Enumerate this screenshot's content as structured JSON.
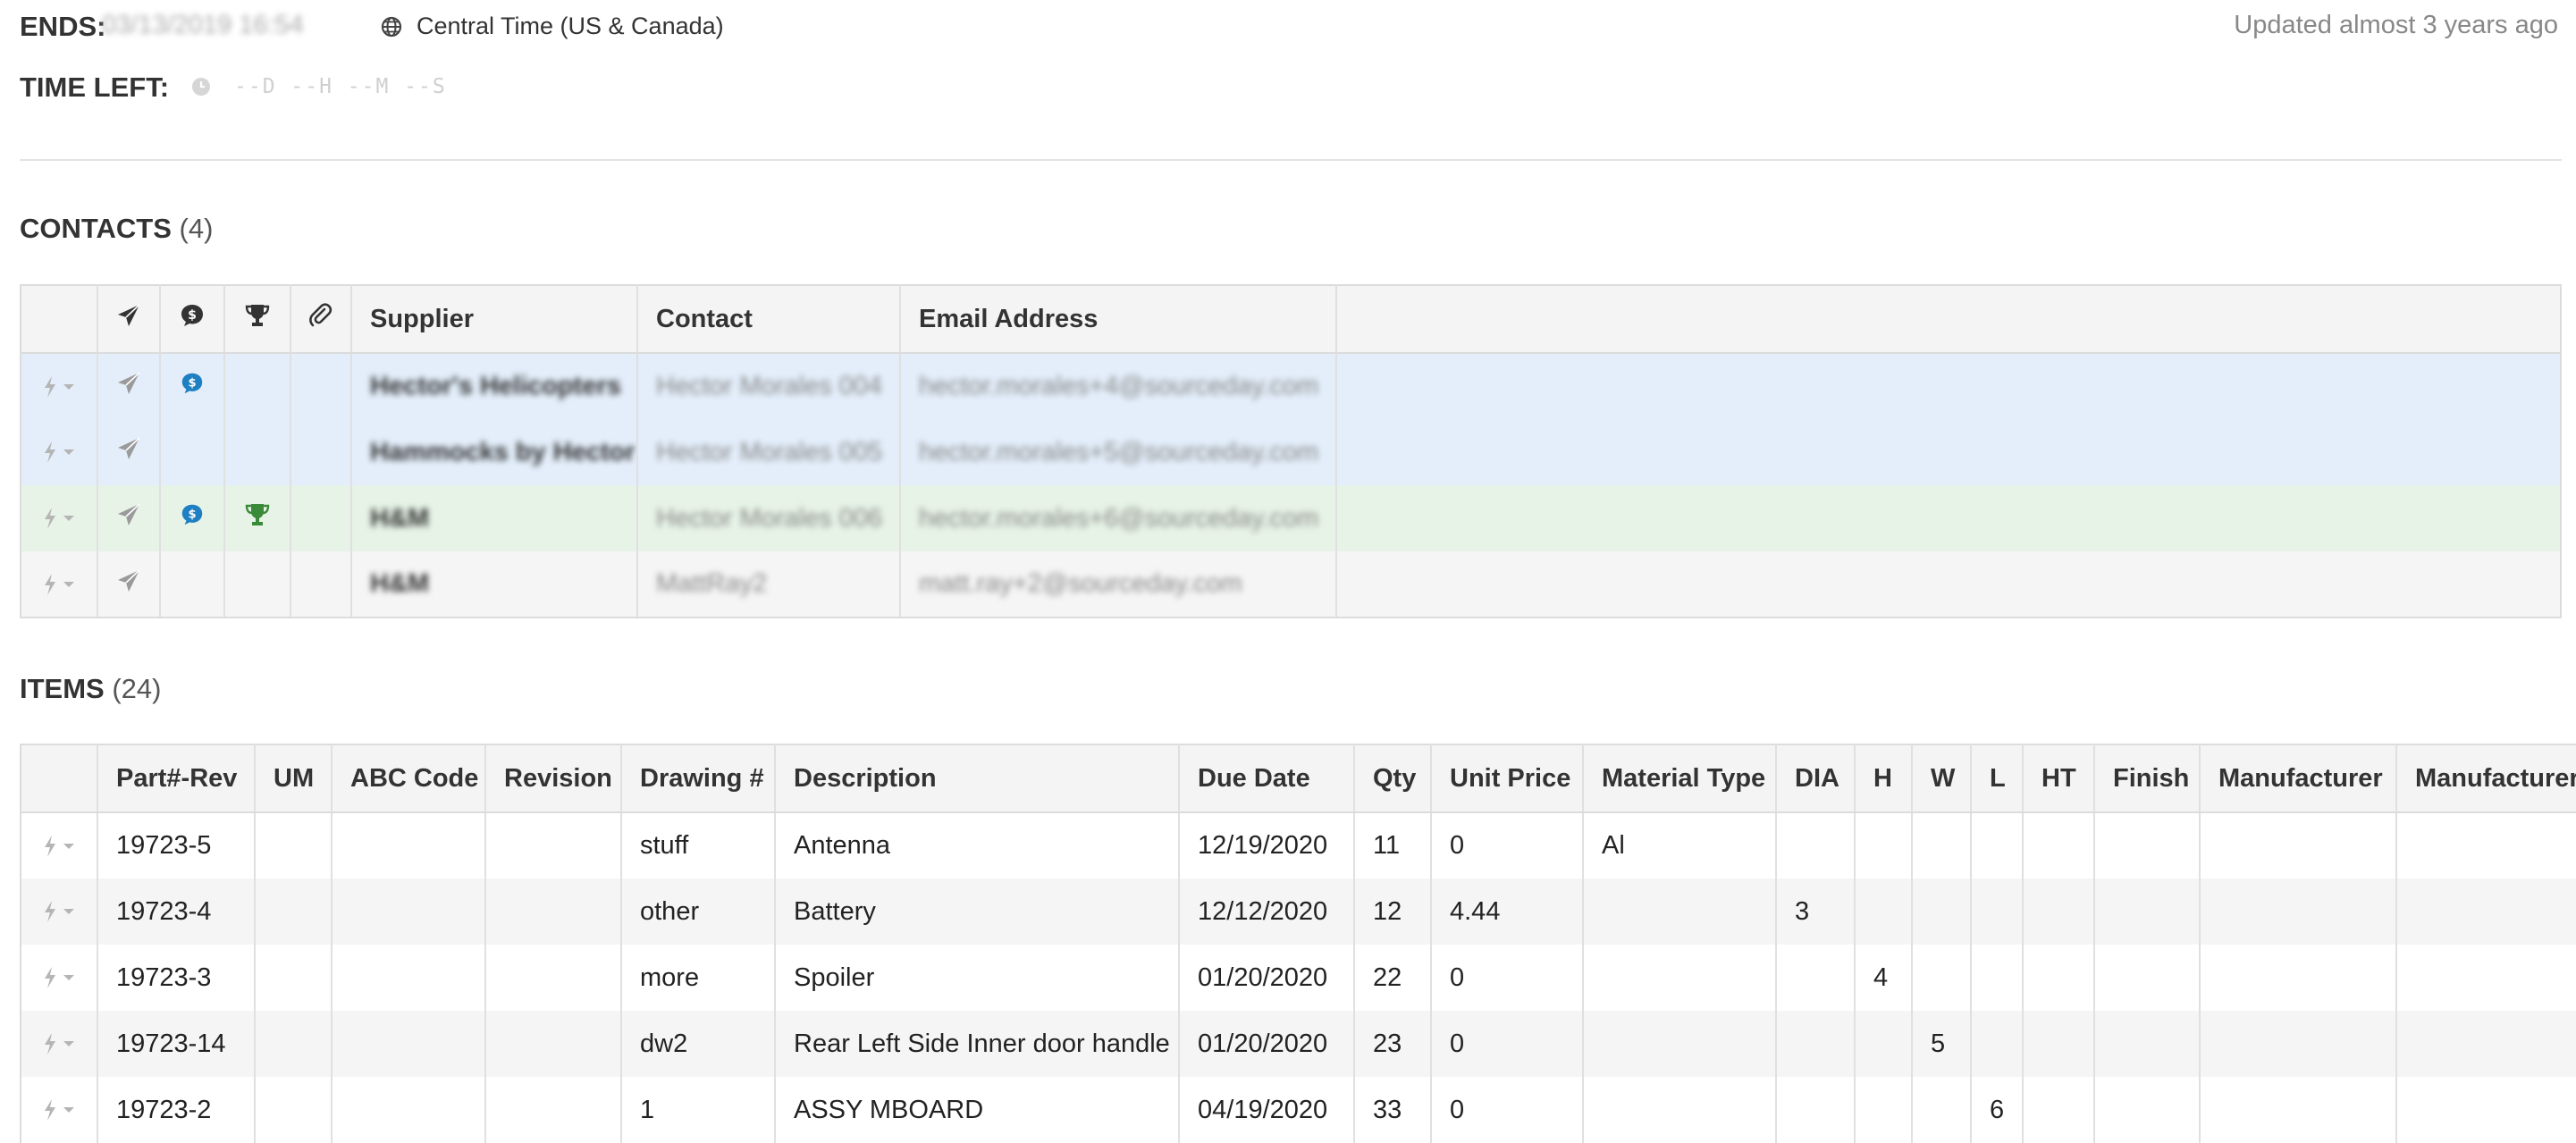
{
  "header": {
    "ends_label": "ENDS:",
    "ends_value": "03/13/2019 16:54",
    "timezone": "Central Time (US & Canada)",
    "updated": "Updated almost 3 years ago",
    "time_left_label": "TIME LEFT:",
    "time_left_value": "--D --H --M --S"
  },
  "contacts": {
    "title": "CONTACTS",
    "count": "(4)",
    "icon_headers": [
      "send-icon",
      "bid-icon",
      "trophy-icon",
      "attachment-icon"
    ],
    "columns": [
      "Supplier",
      "Contact",
      "Email Address"
    ],
    "rows": [
      {
        "supplier": "Hector's Helicopters",
        "contact": "Hector Morales 004",
        "email": "hector.morales+4@sourceday.com",
        "bid": true,
        "trophy": false,
        "tint": "blue"
      },
      {
        "supplier": "Hammocks by Hector",
        "contact": "Hector Morales 005",
        "email": "hector.morales+5@sourceday.com",
        "bid": false,
        "trophy": false,
        "tint": "blue"
      },
      {
        "supplier": "H&M",
        "contact": "Hector Morales 006",
        "email": "hector.morales+6@sourceday.com",
        "bid": true,
        "trophy": true,
        "tint": "green"
      },
      {
        "supplier": "H&M",
        "contact": "MattRay2",
        "email": "matt.ray+2@sourceday.com",
        "bid": false,
        "trophy": false,
        "tint": "grey"
      }
    ]
  },
  "items": {
    "title": "ITEMS",
    "count": "(24)",
    "columns": [
      "Part#-Rev",
      "UM",
      "ABC Code",
      "Revision",
      "Drawing #",
      "Description",
      "Due Date",
      "Qty",
      "Unit Price",
      "Material Type",
      "DIA",
      "H",
      "W",
      "L",
      "HT",
      "Finish",
      "Manufacturer",
      "Manufacturer"
    ],
    "rows": [
      [
        "19723-5",
        "",
        "",
        "",
        "stuff",
        "Antenna",
        "12/19/2020",
        "11",
        "0",
        "Al",
        "",
        "",
        "",
        "",
        "",
        "",
        "",
        ""
      ],
      [
        "19723-4",
        "",
        "",
        "",
        "other",
        "Battery",
        "12/12/2020",
        "12",
        "4.44",
        "",
        "3",
        "",
        "",
        "",
        "",
        "",
        "",
        ""
      ],
      [
        "19723-3",
        "",
        "",
        "",
        "more",
        "Spoiler",
        "01/20/2020",
        "22",
        "0",
        "",
        "",
        "4",
        "",
        "",
        "",
        "",
        "",
        ""
      ],
      [
        "19723-14",
        "",
        "",
        "",
        "dw2",
        "Rear Left Side Inner door handle",
        "01/20/2020",
        "23",
        "0",
        "",
        "",
        "",
        "5",
        "",
        "",
        "",
        "",
        ""
      ],
      [
        "19723-2",
        "",
        "",
        "",
        "1",
        "ASSY MBOARD",
        "04/19/2020",
        "33",
        "0",
        "",
        "",
        "",
        "",
        "6",
        "",
        "",
        "",
        ""
      ]
    ]
  },
  "colors": {
    "row_blue": "#e3eefa",
    "row_green": "#e7f3e7",
    "bid_blue": "#1e7fc2",
    "trophy_green": "#3a8a3a"
  }
}
